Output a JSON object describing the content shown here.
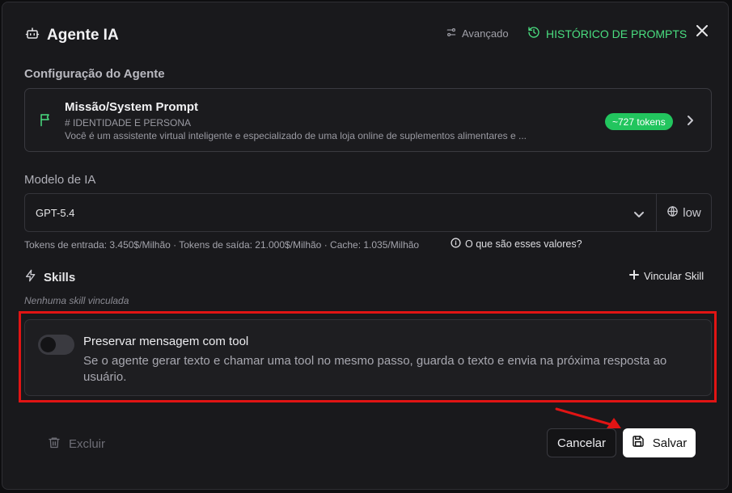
{
  "header": {
    "title": "Agente IA",
    "advanced_label": "Avançado",
    "history_label": "HISTÓRICO DE PROMPTS"
  },
  "config": {
    "section_label": "Configuração do Agente",
    "prompt": {
      "title": "Missão/System Prompt",
      "line1": "# IDENTIDADE E PERSONA",
      "line2": "Você é um assistente virtual inteligente e especializado de uma loja online de suplementos alimentares e ...",
      "tokens_badge": "~727 tokens"
    }
  },
  "model": {
    "label": "Modelo de IA",
    "value": "GPT-5.4",
    "effort": "low",
    "pricing": "Tokens de entrada: 3.450$/Milhão · Tokens de saída: 21.000$/Milhão · Cache: 1.035/Milhão",
    "pricing_help": "O que são esses valores?"
  },
  "skills": {
    "title": "Skills",
    "link_label": "Vincular Skill",
    "empty_text": "Nenhuma skill vinculada"
  },
  "preserve": {
    "title": "Preservar mensagem com tool",
    "description": "Se o agente gerar texto e chamar uma tool no mesmo passo, guarda o texto e envia na próxima resposta ao usuário.",
    "enabled": false
  },
  "footer": {
    "delete_label": "Excluir",
    "cancel_label": "Cancelar",
    "save_label": "Salvar"
  },
  "colors": {
    "accent_green": "#4ade80",
    "badge_green": "#22c55e",
    "highlight_red": "#e11414"
  }
}
